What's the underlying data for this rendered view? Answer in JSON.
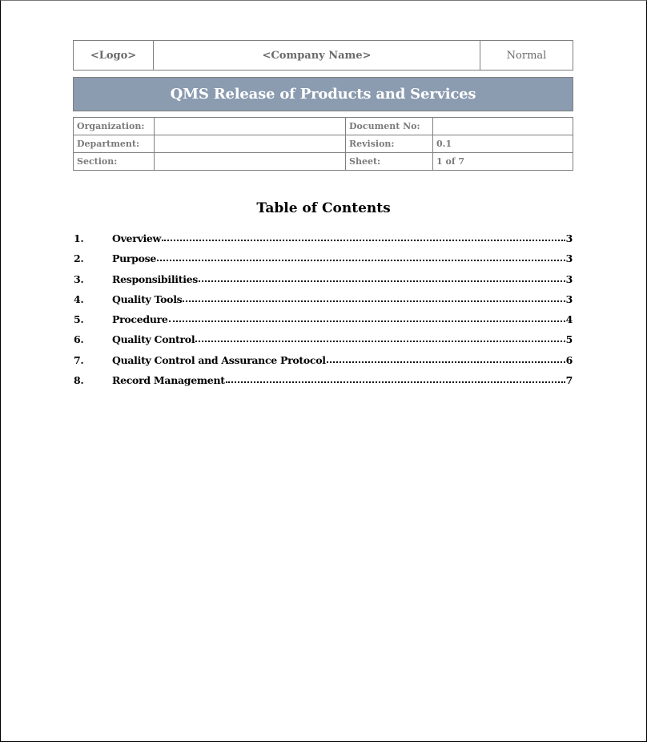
{
  "header": {
    "logo": "<Logo>",
    "company_name": "<Company Name>",
    "style_label": "Normal"
  },
  "title_bar": {
    "title": "QMS Release of Products and Services",
    "background_color": "#8b9bb0"
  },
  "meta": {
    "rows": [
      {
        "label_left": "Organization:",
        "value_left": "",
        "label_right": "Document No:",
        "value_right": ""
      },
      {
        "label_left": "Department:",
        "value_left": "",
        "label_right": "Revision:",
        "value_right": "0.1"
      },
      {
        "label_left": "Section:",
        "value_left": "",
        "label_right": "Sheet:",
        "value_right": "1 of 7"
      }
    ]
  },
  "toc": {
    "title": "Table of Contents",
    "entries": [
      {
        "num": "1.",
        "label": "Overview",
        "page": "3"
      },
      {
        "num": "2.",
        "label": "Purpose",
        "page": "3"
      },
      {
        "num": "3.",
        "label": "Responsibilities",
        "page": "3"
      },
      {
        "num": "4.",
        "label": "Quality Tools",
        "page": "3"
      },
      {
        "num": "5.",
        "label": "Procedure",
        "page": "4"
      },
      {
        "num": "6.",
        "label": "Quality Control",
        "page": "5"
      },
      {
        "num": "7.",
        "label": "Quality Control and Assurance Protocol",
        "page": "6"
      },
      {
        "num": "8.",
        "label": "Record Management",
        "page": "7"
      }
    ]
  }
}
